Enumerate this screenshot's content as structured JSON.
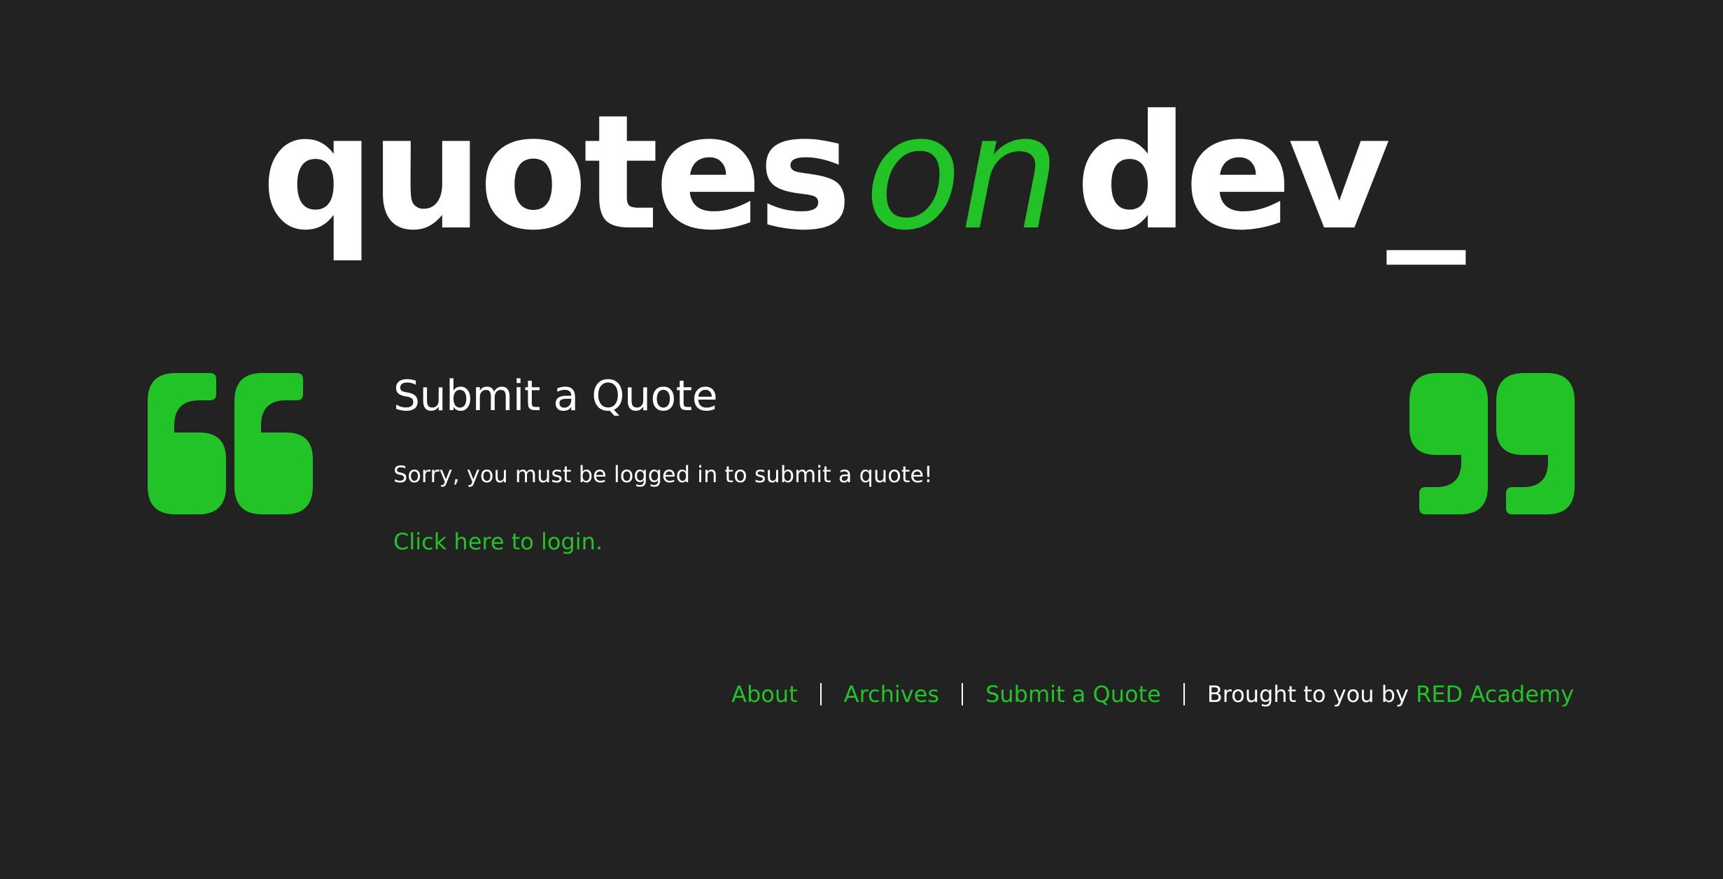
{
  "logo": {
    "part1": "quotes",
    "part2": "on",
    "part3": "dev_"
  },
  "main": {
    "title": "Submit a Quote",
    "message": "Sorry, you must be logged in to submit a quote!",
    "login_link": "Click here to login."
  },
  "footer": {
    "links": [
      {
        "label": "About"
      },
      {
        "label": "Archives"
      },
      {
        "label": "Submit a Quote"
      }
    ],
    "credit_text": "Brought to you by",
    "credit_link": "RED Academy"
  },
  "icons": {
    "left": "open-quote-icon",
    "right": "close-quote-icon"
  },
  "colors": {
    "background": "#222222",
    "accent": "#22c327",
    "text": "#ffffff"
  }
}
